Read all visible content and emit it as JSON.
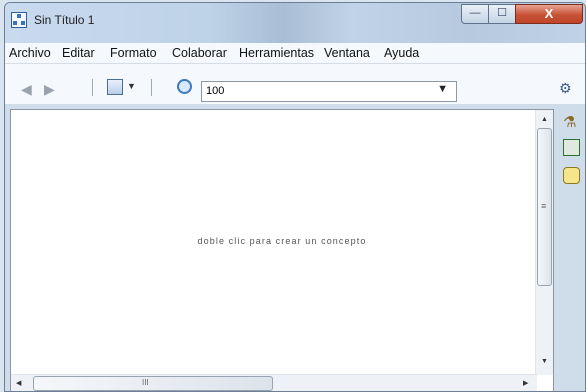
{
  "window": {
    "title": "Sin Título 1"
  },
  "window_buttons": {
    "minimize": "—",
    "maximize": "☐",
    "close": "X"
  },
  "menu": [
    "Archivo",
    "Editar",
    "Formato",
    "Colaborar",
    "Herramientas",
    "Ventana",
    "Ayuda"
  ],
  "toolbar": {
    "zoom_value": "100"
  },
  "canvas": {
    "hint": "doble clic para crear un concepto"
  },
  "scrollbar": {
    "grip": "≡",
    "h_grip": "III"
  },
  "icons": [
    "app-icon",
    "back-arrow-icon",
    "forward-arrow-icon",
    "view-icon",
    "zoom-icon",
    "dropdown-icon",
    "style-palette-icon",
    "ink-bottle-icon",
    "book-icon",
    "info-badge-icon",
    "scroll-up-icon",
    "scroll-down-icon",
    "scroll-left-icon",
    "scroll-right-icon"
  ]
}
